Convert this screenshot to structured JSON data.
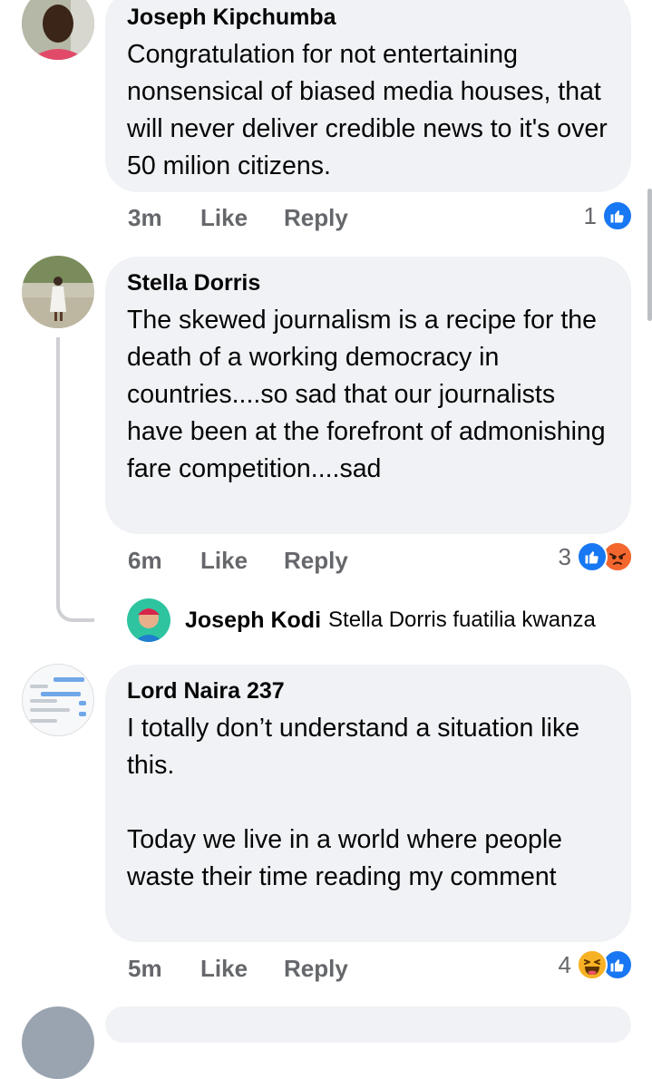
{
  "comments": [
    {
      "author": "Joseph Kipchumba",
      "text": "Congratulation for not entertaining nonsensical of biased media houses, that will never deliver credible news to it's over 50 milion citizens.",
      "time": "3m",
      "like_label": "Like",
      "reply_label": "Reply",
      "reaction_count": "1",
      "reactions": [
        "like-icon"
      ]
    },
    {
      "author": "Stella Dorris",
      "text": "The skewed journalism is a recipe for the death of a working democracy in countries....so sad that our journalists have been at the forefront of admonishing fare competition....sad",
      "time": "6m",
      "like_label": "Like",
      "reply_label": "Reply",
      "reaction_count": "3",
      "reactions": [
        "like-icon",
        "angry-icon"
      ],
      "reply_preview": {
        "author": "Joseph Kodi",
        "text": "Stella Dorris fuatilia kwanza"
      }
    },
    {
      "author": "Lord Naira 237",
      "text": "I totally don’t understand a situation like this.\n\nToday we live in a world where people waste their time reading my comment",
      "time": "5m",
      "like_label": "Like",
      "reply_label": "Reply",
      "reaction_count": "4",
      "reactions": [
        "haha-icon",
        "like-icon"
      ]
    }
  ],
  "colors": {
    "bubble": "#f0f2f5",
    "meta_text": "#65676b",
    "like_blue": "#1877f2",
    "angry_orange": "#f0532a",
    "haha_yellow": "#f7b125"
  }
}
